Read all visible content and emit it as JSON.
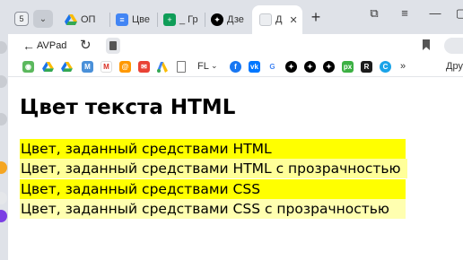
{
  "tabs": {
    "count": "5",
    "items": [
      {
        "label": "ОП"
      },
      {
        "label": "Цве"
      },
      {
        "label": "_ Гр"
      },
      {
        "label": "Дзе"
      },
      {
        "label": "Д"
      }
    ]
  },
  "address_bar": {
    "site_label": "AVPad"
  },
  "bookmarks": {
    "folder_label": "FL",
    "more_label": "»",
    "other_label": "Дру"
  },
  "page": {
    "title": "Цвет текста HTML",
    "rows": [
      {
        "text": "Цвет, заданный средствами HTML",
        "bg": "#ffff00"
      },
      {
        "text": "Цвет, заданный средствами HTML с прозрачностью",
        "bg": "#ffff99"
      },
      {
        "text": "Цвет, заданный средствами CSS",
        "bg": "#ffff00"
      },
      {
        "text": "Цвет, заданный средствами CSS с прозрачностью",
        "bg": "#ffffb0"
      }
    ]
  },
  "colors": {
    "accent_yellow": "#ffff00",
    "tab_strip": "#dfe2e8"
  }
}
